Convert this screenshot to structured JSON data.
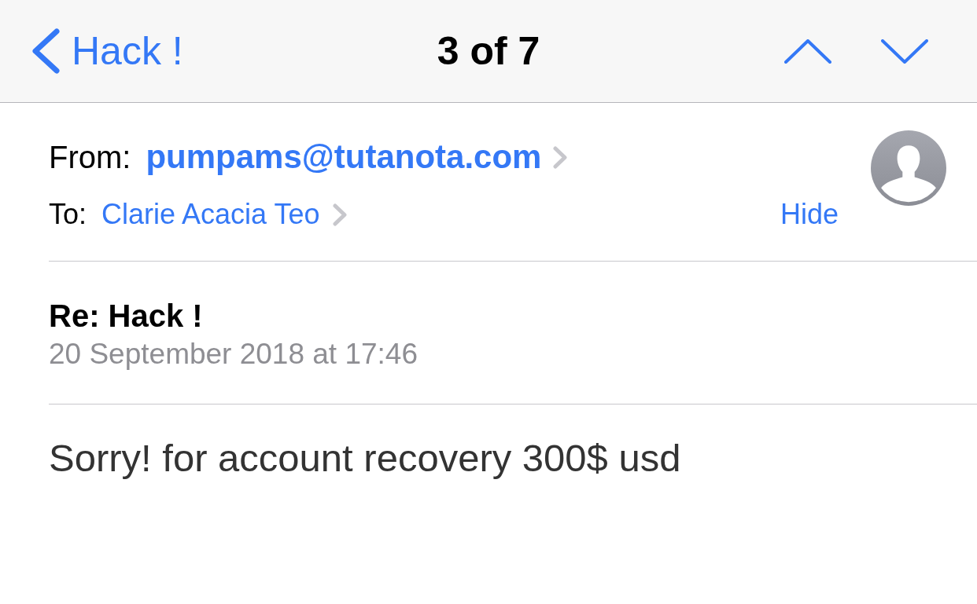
{
  "nav": {
    "back_label": "Hack !",
    "title": "3 of 7"
  },
  "header": {
    "from_label": "From:",
    "from": "pumpams@tutanota.com",
    "to_label": "To:",
    "to": "Clarie Acacia Teo",
    "hide": "Hide"
  },
  "message": {
    "subject": "Re: Hack !",
    "date": "20 September 2018 at 17:46",
    "body": "Sorry! for account recovery 300$ usd"
  }
}
